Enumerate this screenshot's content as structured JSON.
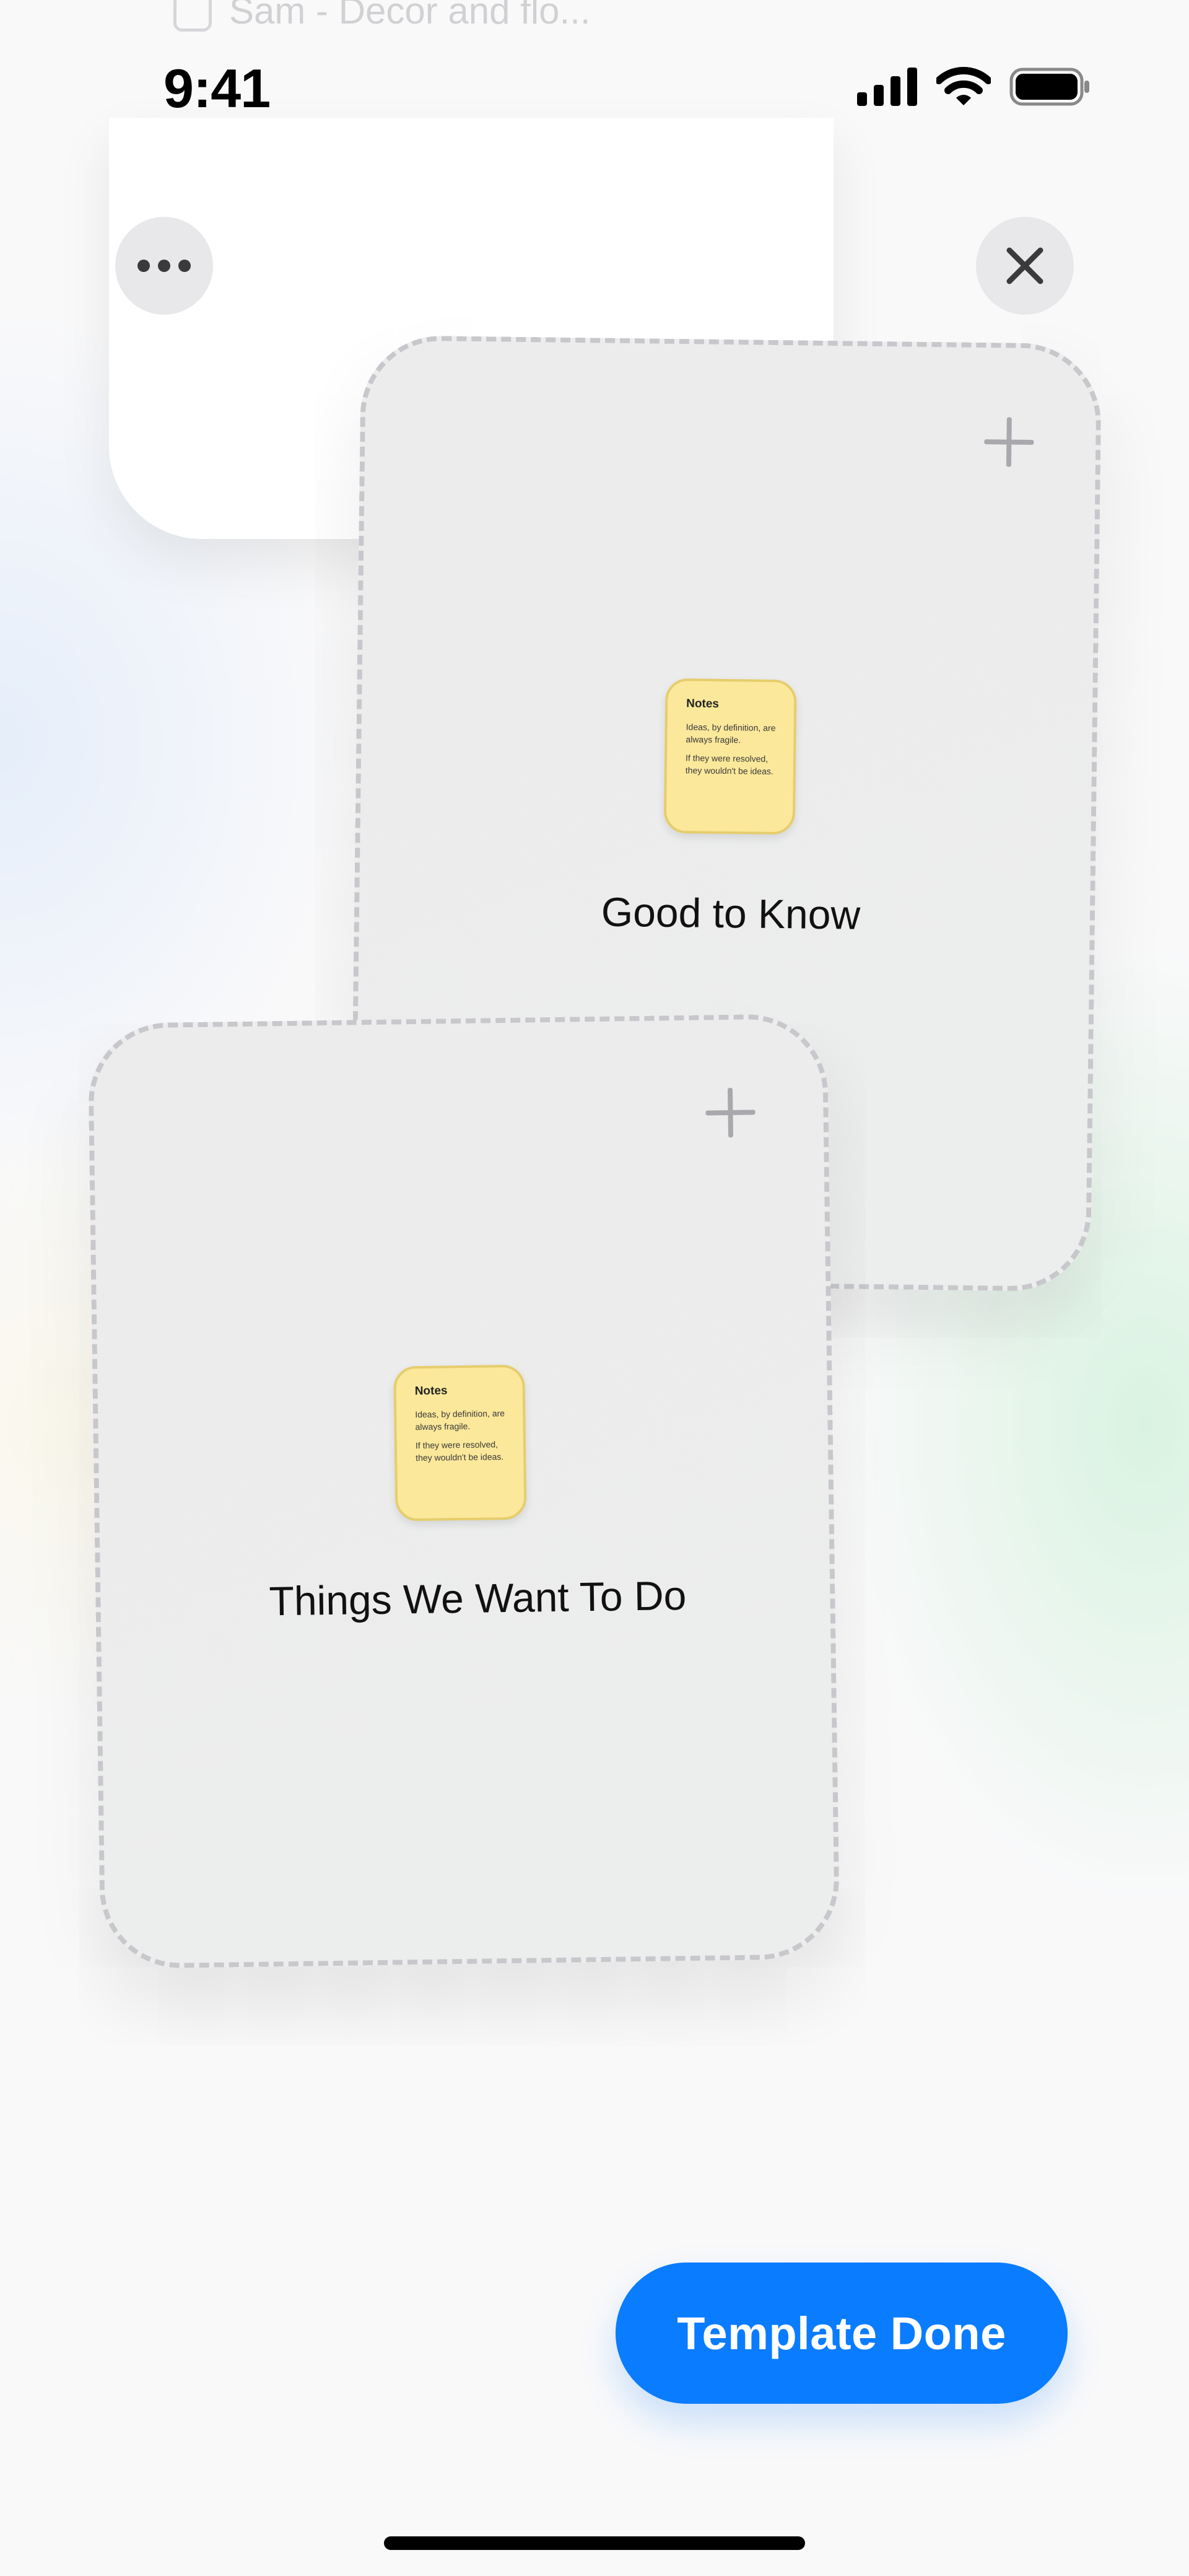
{
  "background_list": {
    "row_text": "Sam - Decor and flo..."
  },
  "status_bar": {
    "time": "9:41",
    "icons": [
      "cellular-signal-icon",
      "wifi-icon",
      "battery-icon"
    ]
  },
  "toolbar": {
    "more_icon": "ellipsis-icon",
    "close_icon": "close-icon"
  },
  "groups": [
    {
      "title": "Good to Know",
      "add_icon": "plus-icon",
      "note": {
        "title": "Notes",
        "lines": [
          "Ideas, by definition, are always fragile.",
          "If they were resolved, they wouldn't be ideas."
        ]
      }
    },
    {
      "title": "Things We Want To Do",
      "add_icon": "plus-icon",
      "note": {
        "title": "Notes",
        "lines": [
          "Ideas, by definition, are always fragile.",
          "If they were resolved, they wouldn't be ideas."
        ]
      }
    }
  ],
  "actions": {
    "done_label": "Template Done"
  },
  "colors": {
    "accent": "#0a7cff",
    "note_fill": "#fbe89a",
    "dashed_border": "#c8c8cc"
  }
}
